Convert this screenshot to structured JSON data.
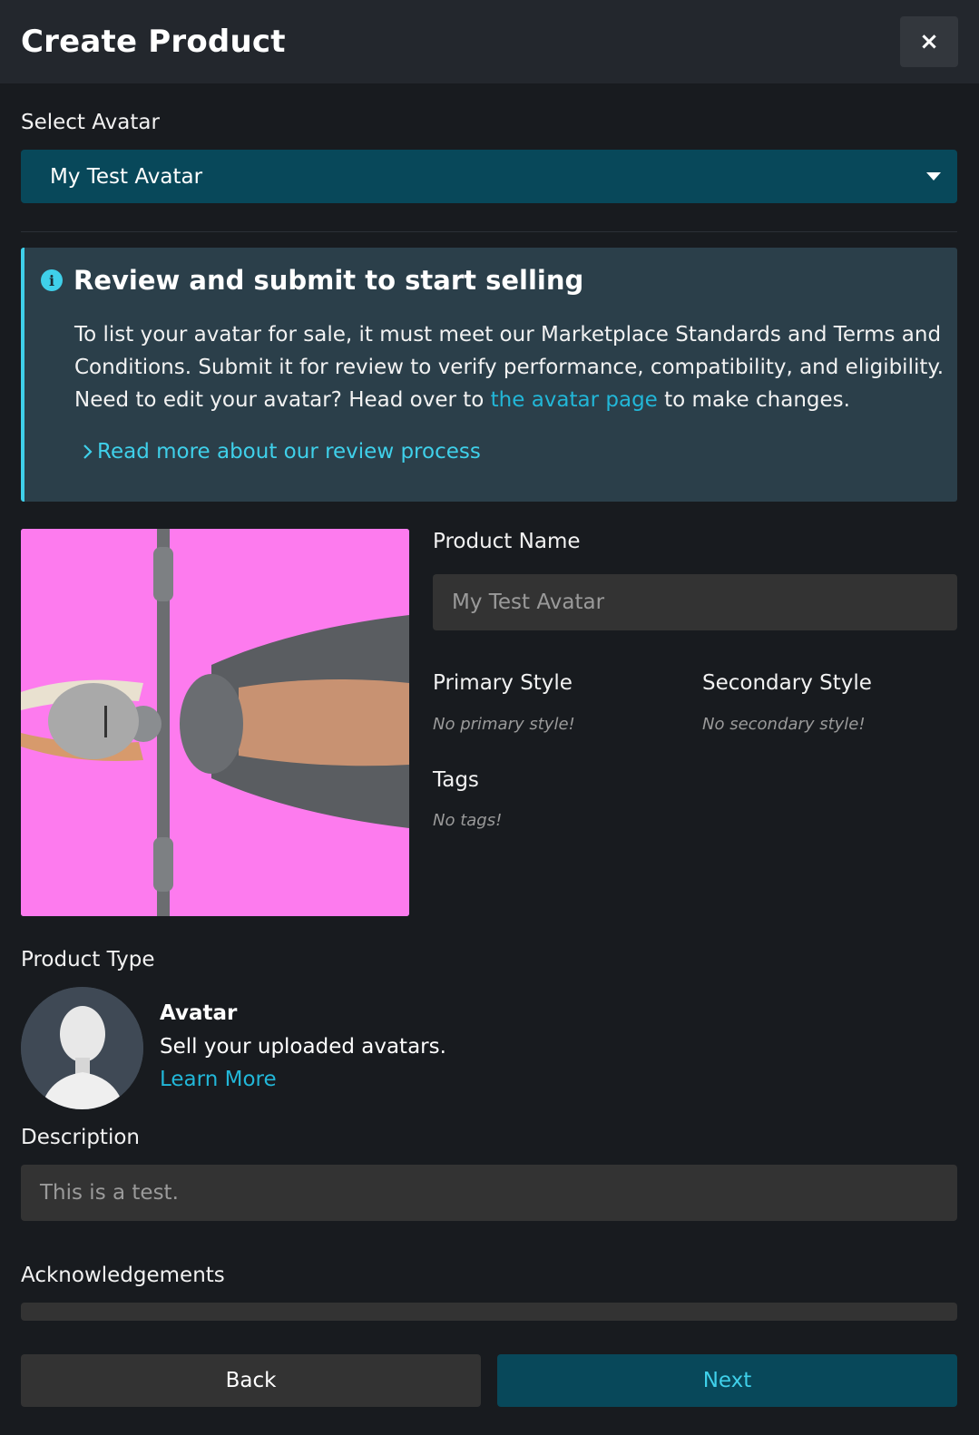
{
  "header": {
    "title": "Create Product",
    "close_label": "×"
  },
  "avatar_select": {
    "label": "Select Avatar",
    "value": "My Test Avatar"
  },
  "info_box": {
    "title": "Review and submit to start selling",
    "body_line1": "To list your avatar for sale, it must meet our Marketplace Standards and Terms and Conditions. Submit it for review to verify performance, compatibility, and eligibility. Need to edit your avatar? Head over to ",
    "body_link": "the avatar page",
    "body_end": " to make changes.",
    "read_more": "Read more about our review process",
    "icon": "info-icon",
    "accent": "#3fd0ea"
  },
  "product": {
    "name_label": "Product Name",
    "name_placeholder": "My Test Avatar",
    "primary_style_label": "Primary Style",
    "primary_style_empty": "No primary style!",
    "secondary_style_label": "Secondary Style",
    "secondary_style_empty": "No secondary style!",
    "tags_label": "Tags",
    "tags_empty": "No tags!"
  },
  "product_type": {
    "label": "Product Type",
    "name": "Avatar",
    "description": "Sell your uploaded avatars.",
    "learn_more": "Learn More"
  },
  "description": {
    "label": "Description",
    "placeholder": "This is a test."
  },
  "acknowledgements": {
    "label": "Acknowledgements"
  },
  "footer": {
    "back_label": "Back",
    "next_label": "Next"
  },
  "colors": {
    "primary": "#08485a",
    "link": "#22b7d8",
    "thumbnail_bg": "#fd7bee"
  }
}
